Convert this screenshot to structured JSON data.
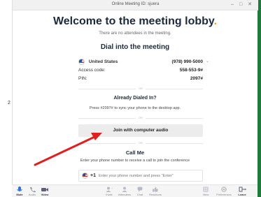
{
  "window": {
    "title": "Online Meeting ID: sjuera",
    "controls": "– □ ✕"
  },
  "left_mark": "2",
  "lobby": {
    "heading": "Welcome to the meeting lobby",
    "heading_dot": ".",
    "subheading": "There are no attendees in the meeting."
  },
  "dial_in": {
    "title": "Dial into the meeting",
    "country": "United States",
    "country_number": "(978) 990-5000",
    "access_code_label": "Access code:",
    "access_code": "558-553-9#",
    "pin_label": "PIN:",
    "pin": "2097#"
  },
  "divider_text": "OR",
  "already_dialed": {
    "title": "Already Dialed In?",
    "text": "Press #2097# to sync your phone to the desktop app."
  },
  "join_audio": {
    "label": "Join with computer audio"
  },
  "call_me": {
    "title": "Call Me",
    "text": "Enter your phone number to receive a call to join the conference",
    "country_code": "+1",
    "placeholder": "Enter your phone number and press \"Enter\""
  },
  "toolbar": {
    "left": [
      {
        "name": "mute",
        "label": "Mute"
      },
      {
        "name": "audio",
        "label": "Audio"
      },
      {
        "name": "video",
        "label": "Video"
      }
    ],
    "center": [
      {
        "name": "invite",
        "label": "Invite"
      },
      {
        "name": "attendees",
        "label": "Attendees"
      },
      {
        "name": "chat",
        "label": "Chat"
      },
      {
        "name": "reactions",
        "label": "Reactions"
      }
    ],
    "right": [
      {
        "name": "view",
        "label": "View"
      },
      {
        "name": "preferences",
        "label": "Preferences"
      },
      {
        "name": "leave",
        "label": "Leave"
      }
    ]
  },
  "colors": {
    "accent": "#f29b1d",
    "arrow": "#e02020",
    "mic": "#2f6fe0",
    "green_edge": "#1f7a3c"
  }
}
